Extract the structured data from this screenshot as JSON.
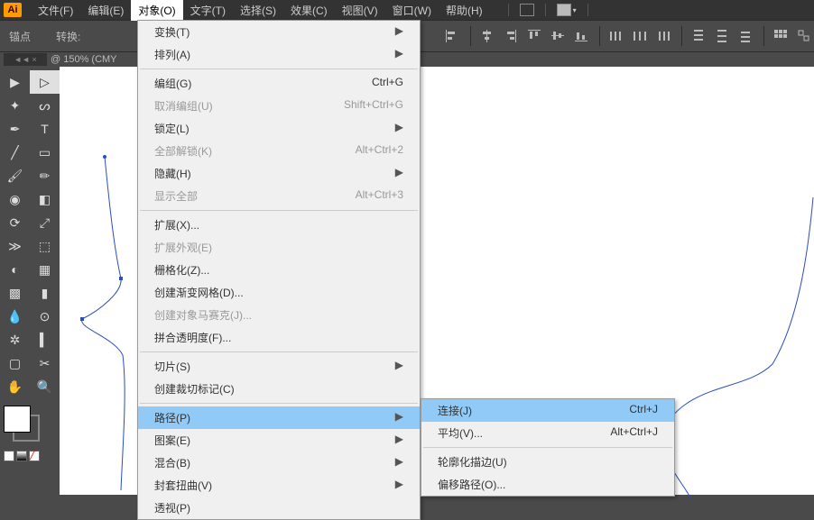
{
  "app_logo": "Ai",
  "menubar": {
    "file": "文件(F)",
    "edit": "编辑(E)",
    "object": "对象(O)",
    "type": "文字(T)",
    "select": "选择(S)",
    "effect": "效果(C)",
    "view": "视图(V)",
    "window": "窗口(W)",
    "help": "帮助(H)"
  },
  "toolbar2": {
    "label1": "锚点",
    "label2": "转换:"
  },
  "doc_tab_info": "@ 150% (CMY",
  "panel_handle": "◄◄ ×",
  "dropdown": {
    "transform": {
      "label": "变换(T)",
      "arrow": "▶"
    },
    "arrange": {
      "label": "排列(A)",
      "arrow": "▶"
    },
    "group": {
      "label": "编组(G)",
      "shortcut": "Ctrl+G"
    },
    "ungroup": {
      "label": "取消编组(U)",
      "shortcut": "Shift+Ctrl+G"
    },
    "lock": {
      "label": "锁定(L)",
      "arrow": "▶"
    },
    "unlock_all": {
      "label": "全部解锁(K)",
      "shortcut": "Alt+Ctrl+2"
    },
    "hide": {
      "label": "隐藏(H)",
      "arrow": "▶"
    },
    "show_all": {
      "label": "显示全部",
      "shortcut": "Alt+Ctrl+3"
    },
    "expand": {
      "label": "扩展(X)..."
    },
    "expand_appearance": {
      "label": "扩展外观(E)"
    },
    "rasterize": {
      "label": "栅格化(Z)..."
    },
    "gradient_mesh": {
      "label": "创建渐变网格(D)..."
    },
    "mosaic": {
      "label": "创建对象马赛克(J)..."
    },
    "flatten": {
      "label": "拼合透明度(F)..."
    },
    "slice": {
      "label": "切片(S)",
      "arrow": "▶"
    },
    "crop_marks": {
      "label": "创建裁切标记(C)"
    },
    "path": {
      "label": "路径(P)",
      "arrow": "▶"
    },
    "pattern": {
      "label": "图案(E)",
      "arrow": "▶"
    },
    "blend": {
      "label": "混合(B)",
      "arrow": "▶"
    },
    "envelope": {
      "label": "封套扭曲(V)",
      "arrow": "▶"
    },
    "perspective": {
      "label": "透视(P)"
    }
  },
  "submenu": {
    "join": {
      "label": "连接(J)",
      "shortcut": "Ctrl+J"
    },
    "average": {
      "label": "平均(V)...",
      "shortcut": "Alt+Ctrl+J"
    },
    "outline": {
      "label": "轮廓化描边(U)"
    },
    "offset": {
      "label": "偏移路径(O)..."
    }
  }
}
